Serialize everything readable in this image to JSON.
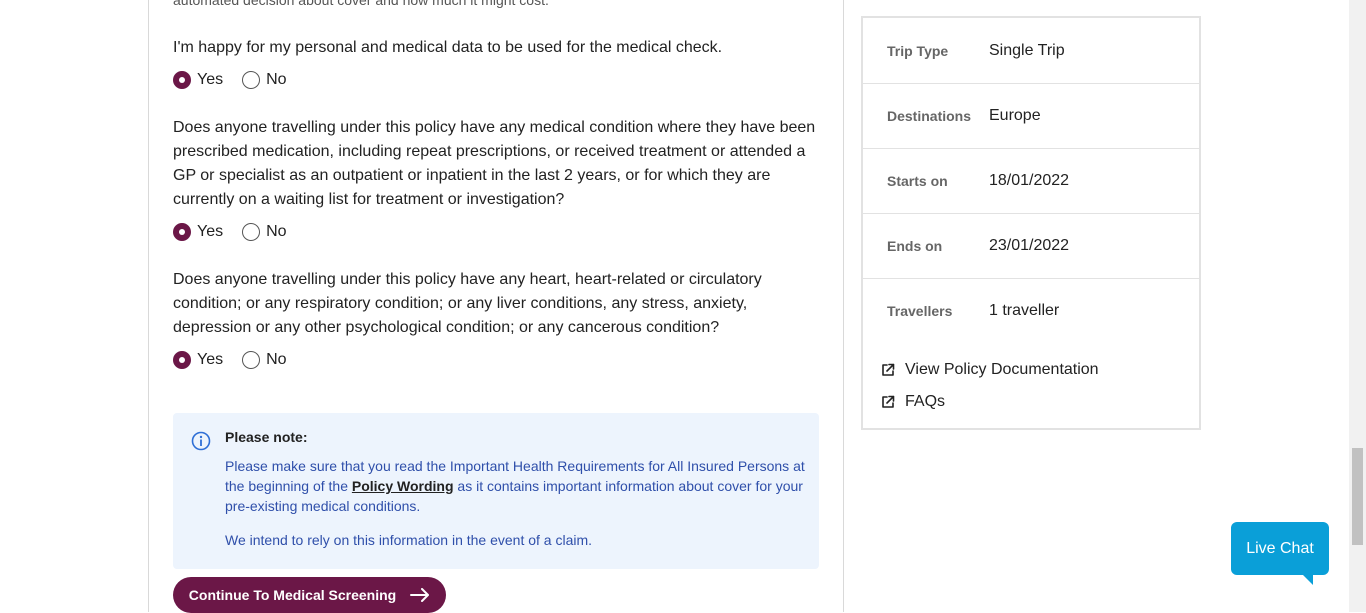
{
  "form": {
    "cut_off_text": "automated decision about cover and how much it might cost.",
    "questions": [
      {
        "text": "I'm happy for my personal and medical data to be used for the medical check.",
        "yes_label": "Yes",
        "no_label": "No",
        "selected": "Yes"
      },
      {
        "text": "Does anyone travelling under this policy have any medical condition where they have been prescribed medication, including repeat prescriptions, or received treatment or attended a GP or specialist as an outpatient or inpatient in the last 2 years, or for which they are currently on a waiting list for treatment or investigation?",
        "yes_label": "Yes",
        "no_label": "No",
        "selected": "Yes"
      },
      {
        "text": "Does anyone travelling under this policy have any heart, heart-related or circulatory condition; or any respiratory condition; or any liver conditions, any stress, anxiety, depression or any other psychological condition; or any cancerous condition?",
        "yes_label": "Yes",
        "no_label": "No",
        "selected": "Yes"
      }
    ]
  },
  "note": {
    "icon": "info-icon",
    "title": "Please note:",
    "body_before": "Please make sure that you read the Important Health Requirements for All Insured Persons at the beginning of the ",
    "link_text": "Policy Wording",
    "body_after": " as it contains important information about cover for your pre-existing medical conditions.",
    "body2": "We intend to rely on this information in the event of a claim."
  },
  "continue_button": {
    "label": "Continue To Medical Screening",
    "icon": "arrow-right-icon"
  },
  "summary": {
    "rows": [
      {
        "label": "Trip Type",
        "value": "Single Trip"
      },
      {
        "label": "Destinations",
        "value": "Europe"
      },
      {
        "label": "Starts on",
        "value": "18/01/2022"
      },
      {
        "label": "Ends on",
        "value": "23/01/2022"
      },
      {
        "label": "Travellers",
        "value": "1 traveller"
      }
    ],
    "links": [
      {
        "label": "View Policy Documentation",
        "icon": "external-link-icon"
      },
      {
        "label": "FAQs",
        "icon": "external-link-icon"
      }
    ]
  },
  "live_chat": {
    "label": "Live Chat"
  },
  "colors": {
    "brand": "#6b1747",
    "note_bg": "#edf4fd",
    "note_text": "#2f4faa",
    "chat": "#0a9fd8"
  }
}
